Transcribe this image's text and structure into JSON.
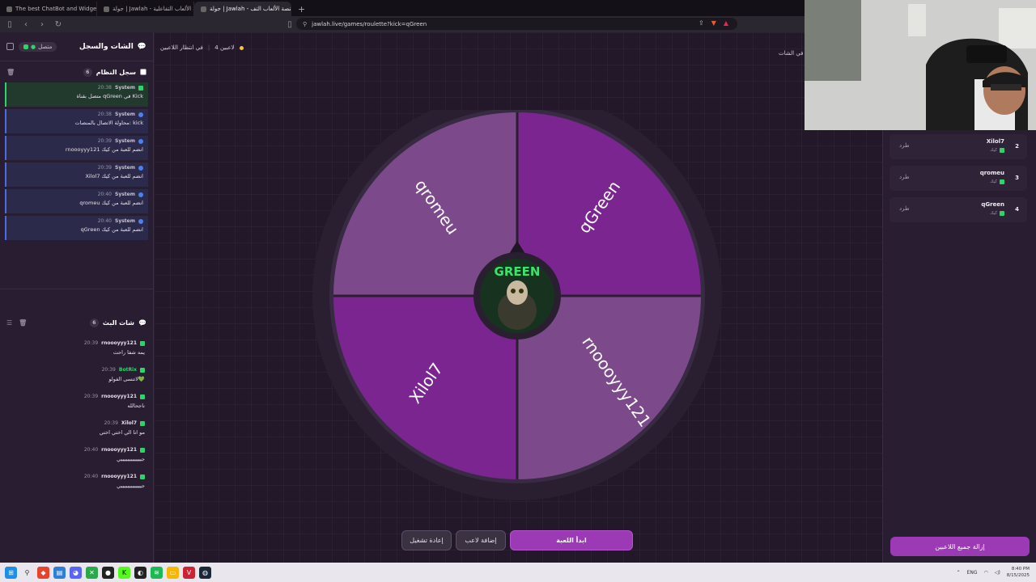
{
  "browser": {
    "tabs": [
      {
        "label": "The best ChatBot and Widgets for K...",
        "active": false
      },
      {
        "label": "جولة | Jawlah - منصة الألعاب التفاعلية",
        "active": false
      },
      {
        "label": "جولة | Jawlah - منصة الألعاب التف...",
        "active": true
      }
    ],
    "url": "jawlah.live/games/roulette?kick=qGreen"
  },
  "left_panel": {
    "title": "الشات والسجل",
    "connection_status": "متصل",
    "system_log": {
      "title": "سجل النظام",
      "count": "6",
      "messages": [
        {
          "sender": "System",
          "time": "20:38",
          "text": "متصل بقناة qGreen في Kick"
        },
        {
          "sender": "System",
          "time": "20:38",
          "text": "محاولة الاتصال بالمنصات: kick"
        },
        {
          "sender": "System",
          "time": "20:39",
          "text": "rnoooyyy121 انضم للعبة من كيك"
        },
        {
          "sender": "System",
          "time": "20:39",
          "text": "Xilol7 انضم للعبة من كيك"
        },
        {
          "sender": "System",
          "time": "20:40",
          "text": "qromeu انضم للعبة من كيك"
        },
        {
          "sender": "System",
          "time": "20:40",
          "text": "qGreen انضم للعبة من كيك"
        }
      ]
    },
    "stream_chat": {
      "title": "شات البث",
      "count": "6",
      "messages": [
        {
          "sender": "rnoooyyy121",
          "time": "20:39",
          "text": "يمه شفا راحت"
        },
        {
          "sender": "BotRix",
          "time": "20:39",
          "text": "لاتنسى الفولو💚"
        },
        {
          "sender": "rnoooyyy121",
          "time": "20:39",
          "text": "ناجحالله"
        },
        {
          "sender": "Xilol7",
          "time": "20:39",
          "text": "مو انا الي اختي اختي"
        },
        {
          "sender": "rnoooyyy121",
          "time": "20:40",
          "text": "جيييييييييييييي"
        },
        {
          "sender": "rnoooyyy121",
          "time": "20:40",
          "text": "جيييييييييييييي"
        }
      ]
    }
  },
  "main": {
    "player_count": "4 لاعبين",
    "waiting": "في انتظار اللاعبين",
    "chat_hint": "ين في الشات",
    "wheel_segments": [
      {
        "name": "qGreen",
        "color": "#7b2690"
      },
      {
        "name": "rnoooyyy121",
        "color": "#7c4a8a"
      },
      {
        "name": "Xilol7",
        "color": "#7b2690"
      },
      {
        "name": "qromeu",
        "color": "#7c4a8a"
      }
    ],
    "center_logo": "GREEN",
    "buttons": {
      "reset": "إعادة تشغيل",
      "add_player": "إضافة لاعب",
      "start": "ابدأ اللعبة"
    }
  },
  "right_panel": {
    "players": [
      {
        "num": "2",
        "name": "Xilol7",
        "source": "كيك",
        "kick": "طرد"
      },
      {
        "num": "3",
        "name": "qromeu",
        "source": "كيك",
        "kick": "طرد"
      },
      {
        "num": "4",
        "name": "qGreen",
        "source": "كيك",
        "kick": "طرد"
      }
    ],
    "clear_all": "إزالة جميع اللاعبين"
  },
  "taskbar": {
    "time": "8:40 PM",
    "date": "8/15/2025"
  },
  "colors": {
    "accent": "#9c3ab5",
    "kick_green": "#2fd36c",
    "background": "#221829"
  }
}
